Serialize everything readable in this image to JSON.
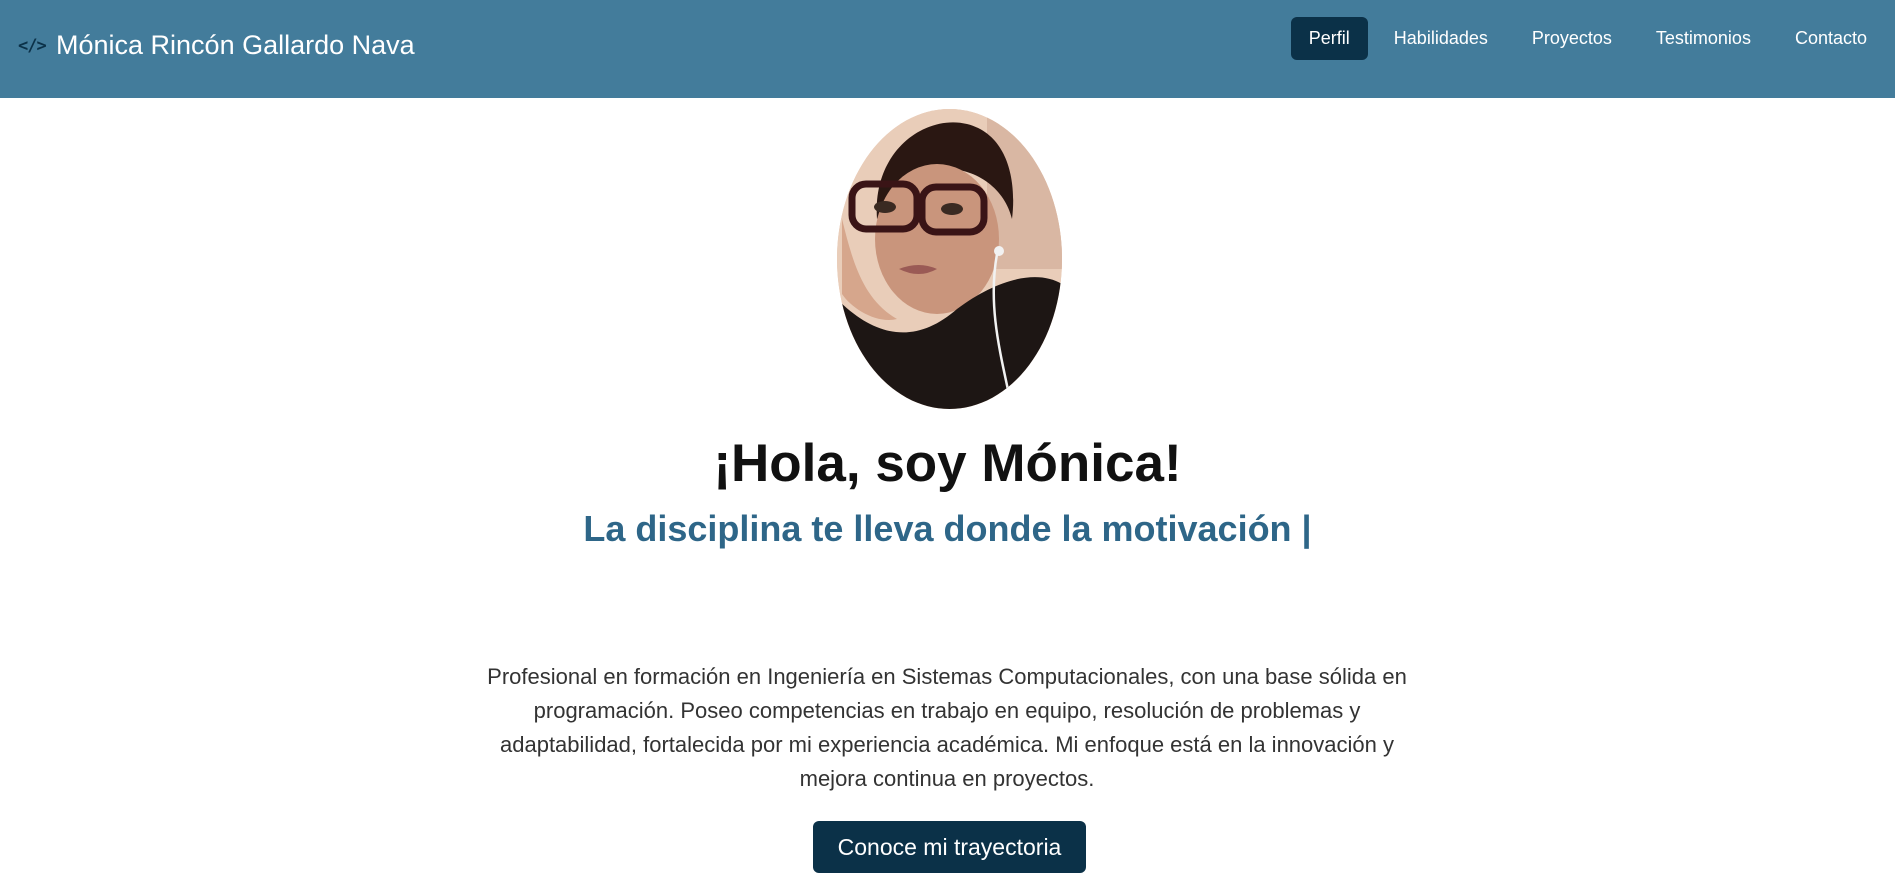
{
  "header": {
    "brand_icon": "</>",
    "brand_name": "Mónica Rincón Gallardo Nava",
    "background_color": "#437c9b",
    "active_color": "#0b3148",
    "nav": [
      {
        "label": "Perfil",
        "active": true
      },
      {
        "label": "Habilidades",
        "active": false
      },
      {
        "label": "Proyectos",
        "active": false
      },
      {
        "label": "Testimonios",
        "active": false
      },
      {
        "label": "Contacto",
        "active": false
      }
    ]
  },
  "hero": {
    "avatar_icon": "profile-photo",
    "greeting": "¡Hola, soy Mónica!",
    "tagline": "La disciplina te lleva donde la motivación |",
    "description": "Profesional en formación en Ingeniería en Sistemas Computacionales, con una base sólida en programación. Poseo competencias en trabajo en equipo, resolución de problemas y adaptabilidad, fortalecida por mi experiencia académica. Mi enfoque está en la innovación y mejora continua en proyectos.",
    "cta_label": "Conoce mi trayectoria",
    "tagline_color": "#2e6688",
    "cta_color": "#0b3148"
  }
}
